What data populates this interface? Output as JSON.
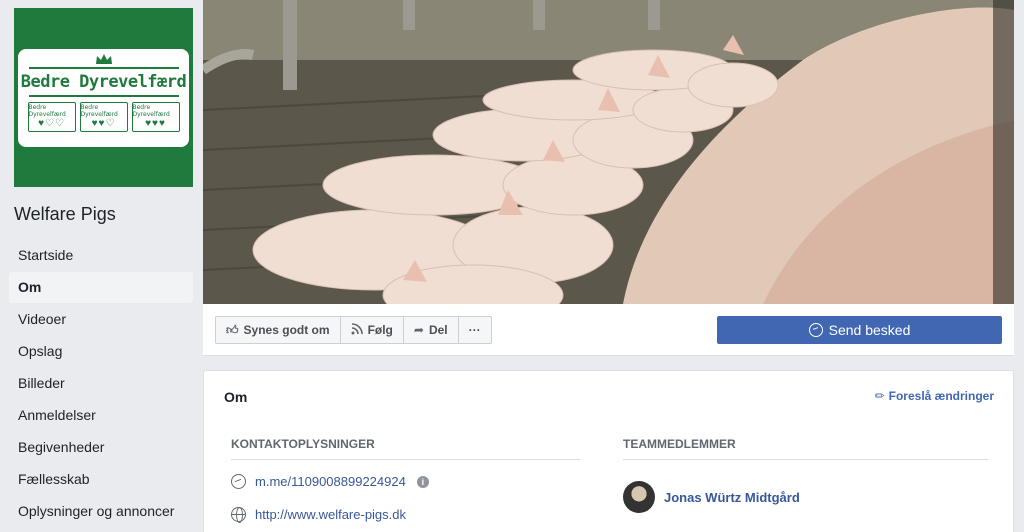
{
  "page": {
    "name": "Welfare Pigs",
    "logo": {
      "brand_text": "Bedre Dyrevelfærd",
      "badge_label": "Bedre Dyrevelfærd"
    }
  },
  "nav": {
    "items": [
      {
        "label": "Startside",
        "active": false
      },
      {
        "label": "Om",
        "active": true
      },
      {
        "label": "Videoer",
        "active": false
      },
      {
        "label": "Opslag",
        "active": false
      },
      {
        "label": "Billeder",
        "active": false
      },
      {
        "label": "Anmeldelser",
        "active": false
      },
      {
        "label": "Begivenheder",
        "active": false
      },
      {
        "label": "Fællesskab",
        "active": false
      },
      {
        "label": "Oplysninger og annoncer",
        "active": false
      }
    ]
  },
  "actions": {
    "like": {
      "label": "Synes godt om",
      "icon": "thumbs-up-icon"
    },
    "follow": {
      "label": "Følg",
      "icon": "rss-icon"
    },
    "share": {
      "label": "Del",
      "icon": "share-arrow-icon"
    },
    "more": {
      "label": "···",
      "icon": "more-icon"
    },
    "send_message": {
      "label": "Send besked",
      "icon": "messenger-icon"
    }
  },
  "about": {
    "title": "Om",
    "suggest_edits": "Foreslå ændringer",
    "contact_heading": "KONTAKTOPLYSNINGER",
    "team_heading": "TEAMMEDLEMMER",
    "messenger_link": "m.me/1109008899224924",
    "website": "http://www.welfare-pigs.dk",
    "team_member": "Jonas Würtz Midtgård"
  },
  "colors": {
    "brand_green": "#1f7a3d",
    "primary_blue": "#4267b2",
    "link_blue": "#385898"
  }
}
